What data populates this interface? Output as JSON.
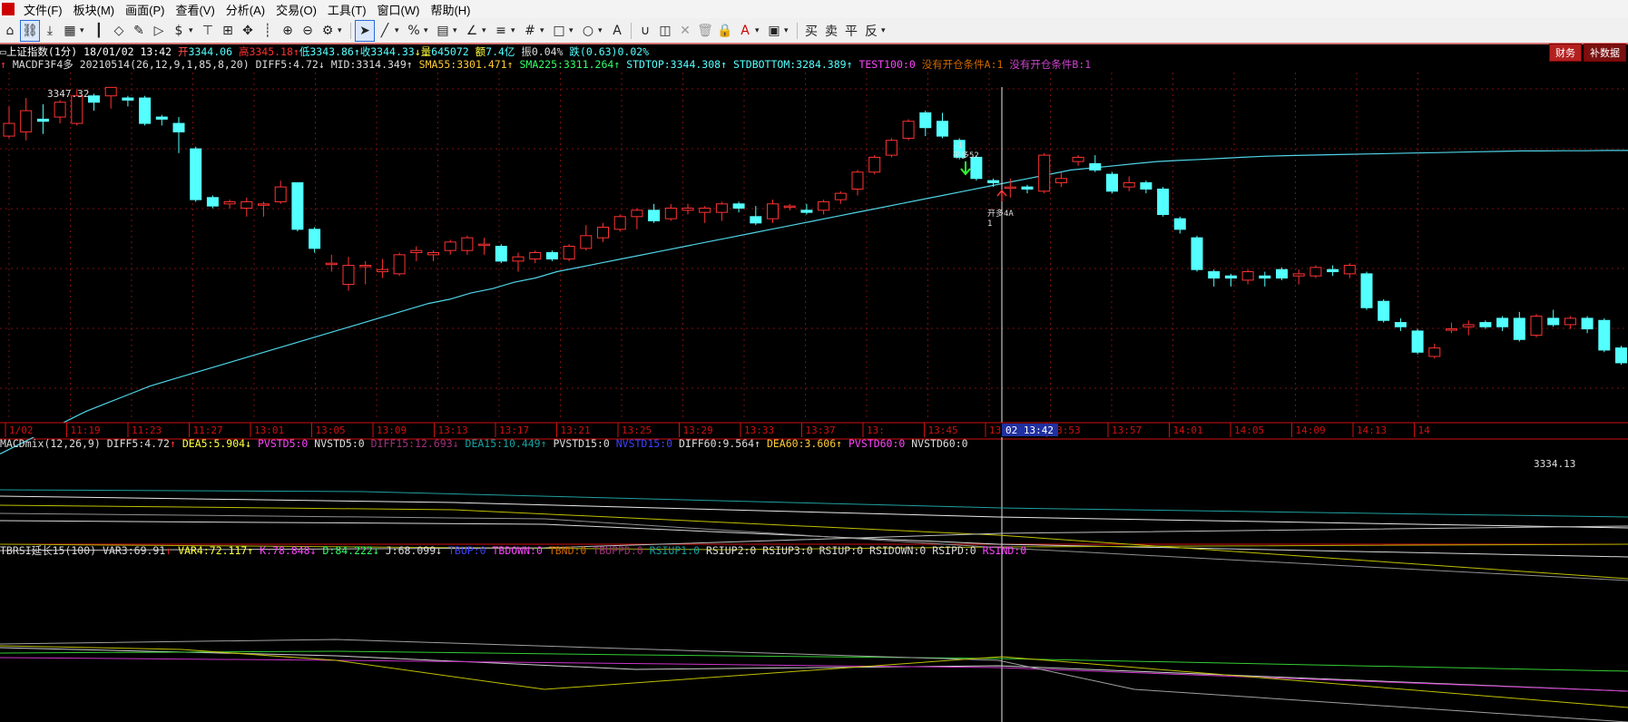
{
  "menu": {
    "items": [
      "文件(F)",
      "板块(M)",
      "画面(P)",
      "查看(V)",
      "分析(A)",
      "交易(O)",
      "工具(T)",
      "窗口(W)",
      "帮助(H)"
    ]
  },
  "toolbar": {
    "icons": [
      "home-icon",
      "link-icon",
      "download-icon",
      "grid-icon",
      "candle-icon",
      "diamond-icon",
      "edit-icon",
      "play-icon",
      "dollar-icon",
      "filter-icon",
      "calc-icon",
      "move-icon",
      "bar-icon",
      "zoom-in-icon",
      "zoom-out-icon",
      "gear-icon",
      "cursor-icon",
      "line-icon",
      "percent-icon",
      "ruler-icon",
      "angle-icon",
      "hline-icon",
      "grid2-icon",
      "rect-icon",
      "circle-icon",
      "text-icon",
      "magnet-icon",
      "layer-icon",
      "close-icon",
      "trash-icon",
      "lock-icon",
      "font-color-icon",
      "save-icon"
    ],
    "text_buttons": [
      "买",
      "卖",
      "平",
      "反"
    ]
  },
  "tabs": [
    "财务",
    "补数据"
  ],
  "header": {
    "symbol": "上证指数(1分)",
    "date": "18/01/02 13:42",
    "open_label": "开",
    "open": "3344.06",
    "high_label": "高",
    "high": "3345.18",
    "low_label": "低",
    "low": "3343.86",
    "close_label": "收",
    "close": "3344.33",
    "vol_label": "量",
    "vol": "645072",
    "amt_label": "额",
    "amt": "7.4亿",
    "amp_label": "振",
    "amp": "0.04%",
    "chg_label": "跌",
    "chg": "(0.63)",
    "chg_pct": "0.02%"
  },
  "main_indicator": {
    "name": "MACDF3F4多",
    "params": "20210514(26,12,9,1,85,8,20)",
    "diff5": "DIFF5:4.72",
    "mid": "MID:3314.349",
    "sma55": "SMA55:3301.471",
    "sma225": "SMA225:3311.264",
    "stdtop": "STDTOP:3344.308",
    "stdbottom": "STDBOTTOM:3284.389",
    "test100": "TEST100:0",
    "cond_a": "没有开仓条件A:1",
    "cond_b": "没有开仓条件B:1"
  },
  "chart_labels": {
    "high_price": "3347.32",
    "low_price": "3334.13",
    "signal_close_top": "-1",
    "signal_close": "平多52",
    "signal_open": "开多4A",
    "signal_open_num": "1"
  },
  "time_axis": {
    "ticks": [
      "1/02",
      "11:19",
      "11:23",
      "11:27",
      "13:01",
      "13:05",
      "13:09",
      "13:13",
      "13:17",
      "13:21",
      "13:25",
      "13:29",
      "13:33",
      "13:37",
      "13:",
      "13:45",
      "13:49",
      "13:53",
      "13:57",
      "14:01",
      "14:05",
      "14:09",
      "14:13",
      "14"
    ],
    "cursor_label": "02 13:42"
  },
  "macd_panel": {
    "name": "MACDmix(12,26,9)",
    "diff5": "DIFF5:4.72",
    "dea5": "DEA5:5.904",
    "pvstd5": "PVSTD5:0",
    "nvstd5": "NVSTD5:0",
    "diff15": "DIFF15:12.693",
    "dea15": "DEA15:10.449",
    "pvstd15": "PVSTD15:0",
    "nvstd15": "NVSTD15:0",
    "diff60": "DIFF60:9.564",
    "dea60": "DEA60:3.606",
    "pvstd60": "PVSTD60:0",
    "nvstd60": "NVSTD60:0"
  },
  "rsi_panel": {
    "name": "TBRSI延长15(100)",
    "var3": "VAR3:69.91",
    "var4": "VAR4:72.117",
    "k": "K:78.848",
    "d": "D:84.222",
    "j": "J:68.099",
    "tbup": "TBUP:0",
    "tbdown": "TBDOWN:0",
    "tbnd": "TBND:0",
    "tbuppd": "TBUPPD:0",
    "rsiup1": "RSIUP1:0",
    "rsiup2": "RSIUP2:0",
    "rsiup3": "RSIUP3:0",
    "rsiup": "RSIUP:0",
    "rsidown": "RSIDOWN:0",
    "rsipd": "RSIPD:0",
    "rsind": "RSIND:0"
  },
  "colors": {
    "up": "#ff3232",
    "down": "#54ffff",
    "sma_line": "#4fd3e6",
    "grid": "#7a1010",
    "axis_red": "#d01010"
  },
  "chart_data": {
    "type": "candlestick",
    "price_range": [
      3332.5,
      3348.0
    ],
    "candles": [
      {
        "o": 3345.0,
        "c": 3345.6,
        "h": 3346.4,
        "l": 3344.9
      },
      {
        "o": 3345.2,
        "c": 3346.2,
        "h": 3346.8,
        "l": 3344.8
      },
      {
        "o": 3345.8,
        "c": 3345.7,
        "h": 3346.5,
        "l": 3345.1
      },
      {
        "o": 3345.9,
        "c": 3346.6,
        "h": 3346.7,
        "l": 3345.6
      },
      {
        "o": 3345.6,
        "c": 3346.9,
        "h": 3347.2,
        "l": 3345.5
      },
      {
        "o": 3346.9,
        "c": 3346.6,
        "h": 3347.0,
        "l": 3346.2
      },
      {
        "o": 3346.9,
        "c": 3347.3,
        "h": 3347.3,
        "l": 3346.3
      },
      {
        "o": 3346.8,
        "c": 3346.7,
        "h": 3346.9,
        "l": 3346.4
      },
      {
        "o": 3346.8,
        "c": 3345.6,
        "h": 3346.9,
        "l": 3345.5
      },
      {
        "o": 3345.9,
        "c": 3345.8,
        "h": 3346.0,
        "l": 3345.5
      },
      {
        "o": 3345.6,
        "c": 3345.2,
        "h": 3345.9,
        "l": 3344.2
      },
      {
        "o": 3344.4,
        "c": 3342.0,
        "h": 3344.5,
        "l": 3341.9
      },
      {
        "o": 3342.1,
        "c": 3341.7,
        "h": 3342.2,
        "l": 3341.6
      },
      {
        "o": 3341.8,
        "c": 3341.9,
        "h": 3342.0,
        "l": 3341.6
      },
      {
        "o": 3341.6,
        "c": 3341.9,
        "h": 3342.1,
        "l": 3341.2
      },
      {
        "o": 3341.8,
        "c": 3341.8,
        "h": 3341.9,
        "l": 3341.2
      },
      {
        "o": 3341.9,
        "c": 3342.6,
        "h": 3342.9,
        "l": 3341.8
      },
      {
        "o": 3342.8,
        "c": 3340.6,
        "h": 3342.8,
        "l": 3340.5
      },
      {
        "o": 3340.6,
        "c": 3339.7,
        "h": 3340.7,
        "l": 3339.5
      },
      {
        "o": 3339.0,
        "c": 3339.0,
        "h": 3339.4,
        "l": 3338.6
      },
      {
        "o": 3338.0,
        "c": 3338.9,
        "h": 3339.3,
        "l": 3337.7
      },
      {
        "o": 3338.9,
        "c": 3338.9,
        "h": 3339.1,
        "l": 3338.0
      },
      {
        "o": 3338.6,
        "c": 3338.7,
        "h": 3339.2,
        "l": 3338.3
      },
      {
        "o": 3338.5,
        "c": 3339.4,
        "h": 3339.5,
        "l": 3338.4
      },
      {
        "o": 3339.5,
        "c": 3339.6,
        "h": 3339.8,
        "l": 3339.1
      },
      {
        "o": 3339.4,
        "c": 3339.5,
        "h": 3339.6,
        "l": 3339.1
      },
      {
        "o": 3339.6,
        "c": 3340.0,
        "h": 3340.1,
        "l": 3339.4
      },
      {
        "o": 3339.6,
        "c": 3340.2,
        "h": 3340.3,
        "l": 3339.4
      },
      {
        "o": 3339.9,
        "c": 3339.9,
        "h": 3340.2,
        "l": 3339.4
      },
      {
        "o": 3339.8,
        "c": 3339.1,
        "h": 3339.9,
        "l": 3339.0
      },
      {
        "o": 3339.1,
        "c": 3339.3,
        "h": 3339.5,
        "l": 3338.6
      },
      {
        "o": 3339.2,
        "c": 3339.5,
        "h": 3339.6,
        "l": 3339.0
      },
      {
        "o": 3339.5,
        "c": 3339.2,
        "h": 3339.6,
        "l": 3339.1
      },
      {
        "o": 3339.2,
        "c": 3339.8,
        "h": 3339.9,
        "l": 3339.1
      },
      {
        "o": 3339.7,
        "c": 3340.3,
        "h": 3340.8,
        "l": 3339.6
      },
      {
        "o": 3340.2,
        "c": 3340.7,
        "h": 3340.9,
        "l": 3340.0
      },
      {
        "o": 3340.6,
        "c": 3341.2,
        "h": 3341.3,
        "l": 3340.5
      },
      {
        "o": 3341.2,
        "c": 3341.5,
        "h": 3341.6,
        "l": 3340.6
      },
      {
        "o": 3341.5,
        "c": 3341.0,
        "h": 3341.8,
        "l": 3340.9
      },
      {
        "o": 3341.1,
        "c": 3341.6,
        "h": 3341.8,
        "l": 3341.0
      },
      {
        "o": 3341.5,
        "c": 3341.6,
        "h": 3341.8,
        "l": 3341.3
      },
      {
        "o": 3341.4,
        "c": 3341.6,
        "h": 3341.7,
        "l": 3340.9
      },
      {
        "o": 3341.4,
        "c": 3341.8,
        "h": 3341.9,
        "l": 3341.0
      },
      {
        "o": 3341.8,
        "c": 3341.6,
        "h": 3341.9,
        "l": 3341.4
      },
      {
        "o": 3341.2,
        "c": 3340.9,
        "h": 3341.7,
        "l": 3340.8
      },
      {
        "o": 3341.1,
        "c": 3341.8,
        "h": 3342.0,
        "l": 3340.9
      },
      {
        "o": 3341.7,
        "c": 3341.7,
        "h": 3341.8,
        "l": 3341.5
      },
      {
        "o": 3341.5,
        "c": 3341.4,
        "h": 3341.8,
        "l": 3341.3
      },
      {
        "o": 3341.5,
        "c": 3341.9,
        "h": 3342.0,
        "l": 3341.3
      },
      {
        "o": 3342.0,
        "c": 3342.3,
        "h": 3342.4,
        "l": 3341.8
      },
      {
        "o": 3342.5,
        "c": 3343.3,
        "h": 3343.4,
        "l": 3342.2
      },
      {
        "o": 3343.3,
        "c": 3344.0,
        "h": 3344.1,
        "l": 3343.2
      },
      {
        "o": 3344.1,
        "c": 3344.8,
        "h": 3344.9,
        "l": 3344.0
      },
      {
        "o": 3344.9,
        "c": 3345.7,
        "h": 3345.8,
        "l": 3344.8
      },
      {
        "o": 3346.1,
        "c": 3345.4,
        "h": 3346.2,
        "l": 3345.0
      },
      {
        "o": 3345.7,
        "c": 3345.0,
        "h": 3346.1,
        "l": 3344.9
      },
      {
        "o": 3344.8,
        "c": 3344.0,
        "h": 3344.9,
        "l": 3343.9
      },
      {
        "o": 3344.0,
        "c": 3343.0,
        "h": 3344.1,
        "l": 3342.9
      },
      {
        "o": 3342.9,
        "c": 3342.8,
        "h": 3343.0,
        "l": 3342.6
      },
      {
        "o": 3342.6,
        "c": 3342.6,
        "h": 3343.0,
        "l": 3342.1
      },
      {
        "o": 3342.6,
        "c": 3342.5,
        "h": 3342.7,
        "l": 3342.3
      },
      {
        "o": 3342.4,
        "c": 3344.1,
        "h": 3344.2,
        "l": 3342.3
      },
      {
        "o": 3342.8,
        "c": 3343.0,
        "h": 3343.3,
        "l": 3342.6
      },
      {
        "o": 3343.8,
        "c": 3344.0,
        "h": 3344.1,
        "l": 3343.6
      },
      {
        "o": 3343.7,
        "c": 3343.4,
        "h": 3344.1,
        "l": 3343.3
      },
      {
        "o": 3343.2,
        "c": 3342.4,
        "h": 3343.3,
        "l": 3342.3
      },
      {
        "o": 3342.6,
        "c": 3342.8,
        "h": 3343.1,
        "l": 3342.4
      },
      {
        "o": 3342.8,
        "c": 3342.5,
        "h": 3342.9,
        "l": 3342.3
      },
      {
        "o": 3342.5,
        "c": 3341.3,
        "h": 3342.6,
        "l": 3341.2
      },
      {
        "o": 3341.1,
        "c": 3340.6,
        "h": 3341.2,
        "l": 3340.4
      },
      {
        "o": 3340.2,
        "c": 3338.7,
        "h": 3340.3,
        "l": 3338.6
      },
      {
        "o": 3338.6,
        "c": 3338.3,
        "h": 3338.7,
        "l": 3337.9
      },
      {
        "o": 3338.4,
        "c": 3338.3,
        "h": 3338.5,
        "l": 3337.9
      },
      {
        "o": 3338.2,
        "c": 3338.6,
        "h": 3338.7,
        "l": 3338.0
      },
      {
        "o": 3338.4,
        "c": 3338.3,
        "h": 3338.6,
        "l": 3337.9
      },
      {
        "o": 3338.7,
        "c": 3338.3,
        "h": 3338.8,
        "l": 3338.2
      },
      {
        "o": 3338.4,
        "c": 3338.5,
        "h": 3338.7,
        "l": 3338.0
      },
      {
        "o": 3338.4,
        "c": 3338.8,
        "h": 3338.9,
        "l": 3338.3
      },
      {
        "o": 3338.7,
        "c": 3338.6,
        "h": 3338.9,
        "l": 3338.4
      },
      {
        "o": 3338.5,
        "c": 3338.9,
        "h": 3339.0,
        "l": 3338.3
      },
      {
        "o": 3338.5,
        "c": 3336.9,
        "h": 3338.6,
        "l": 3336.8
      },
      {
        "o": 3337.2,
        "c": 3336.3,
        "h": 3337.3,
        "l": 3336.2
      },
      {
        "o": 3336.2,
        "c": 3336.0,
        "h": 3336.4,
        "l": 3335.8
      },
      {
        "o": 3335.8,
        "c": 3334.8,
        "h": 3335.9,
        "l": 3334.7
      },
      {
        "o": 3334.6,
        "c": 3335.0,
        "h": 3335.2,
        "l": 3334.5
      },
      {
        "o": 3335.9,
        "c": 3335.9,
        "h": 3336.2,
        "l": 3335.7
      },
      {
        "o": 3336.0,
        "c": 3336.1,
        "h": 3336.3,
        "l": 3335.6
      },
      {
        "o": 3336.2,
        "c": 3336.0,
        "h": 3336.3,
        "l": 3335.9
      },
      {
        "o": 3336.4,
        "c": 3336.0,
        "h": 3336.5,
        "l": 3335.8
      },
      {
        "o": 3336.4,
        "c": 3335.4,
        "h": 3336.7,
        "l": 3335.3
      },
      {
        "o": 3335.6,
        "c": 3336.5,
        "h": 3336.6,
        "l": 3335.5
      },
      {
        "o": 3336.4,
        "c": 3336.1,
        "h": 3336.8,
        "l": 3336.0
      },
      {
        "o": 3336.1,
        "c": 3336.4,
        "h": 3336.5,
        "l": 3335.9
      },
      {
        "o": 3336.4,
        "c": 3335.9,
        "h": 3336.5,
        "l": 3335.7
      },
      {
        "o": 3336.3,
        "c": 3334.9,
        "h": 3336.4,
        "l": 3334.8
      },
      {
        "o": 3335.0,
        "c": 3334.3,
        "h": 3335.1,
        "l": 3334.2
      },
      {
        "o": 3333.9,
        "c": 3333.3,
        "h": 3334.1,
        "l": 3333.2
      },
      {
        "o": 3333.4,
        "c": 3333.0,
        "h": 3333.5,
        "l": 3332.8
      },
      {
        "o": 3332.7,
        "c": 3331.6,
        "h": 3332.8,
        "l": 3331.5
      },
      {
        "o": 3331.5,
        "c": 3331.1,
        "h": 3331.9,
        "l": 3330.9
      },
      {
        "o": 3331.2,
        "c": 3331.6,
        "h": 3331.9,
        "l": 3330.9
      },
      {
        "o": 3331.5,
        "c": 3332.0,
        "h": 3332.7,
        "l": 3331.3
      },
      {
        "o": 3332.1,
        "c": 3333.0,
        "h": 3333.2,
        "l": 3332.0
      }
    ],
    "sma_line": [
      3330.0,
      3330.5,
      3331.0,
      3331.5,
      3332.0,
      3332.4,
      3332.8,
      3333.2,
      3333.5,
      3333.8,
      3334.1,
      3334.4,
      3334.7,
      3335.0,
      3335.3,
      3335.6,
      3335.9,
      3336.2,
      3336.5,
      3336.8,
      3337.1,
      3337.3,
      3337.6,
      3337.8,
      3338.1,
      3338.3,
      3338.6,
      3338.8,
      3339.0,
      3339.2,
      3339.4,
      3339.6,
      3339.8,
      3340.0,
      3340.2,
      3340.4,
      3340.6,
      3340.8,
      3341.0,
      3341.2,
      3341.4,
      3341.6,
      3341.8,
      3342.0,
      3342.2,
      3342.4,
      3342.6,
      3342.8,
      3343.0,
      3343.2,
      3343.4,
      3343.5,
      3343.6,
      3343.7,
      3343.8,
      3343.85,
      3343.9,
      3343.95,
      3344.0,
      3344.05,
      3344.08,
      3344.1,
      3344.12,
      3344.14,
      3344.16,
      3344.18,
      3344.2,
      3344.22,
      3344.24,
      3344.26,
      3344.28,
      3344.3,
      3344.3,
      3344.31,
      3344.31,
      3344.32,
      3344.32
    ]
  }
}
